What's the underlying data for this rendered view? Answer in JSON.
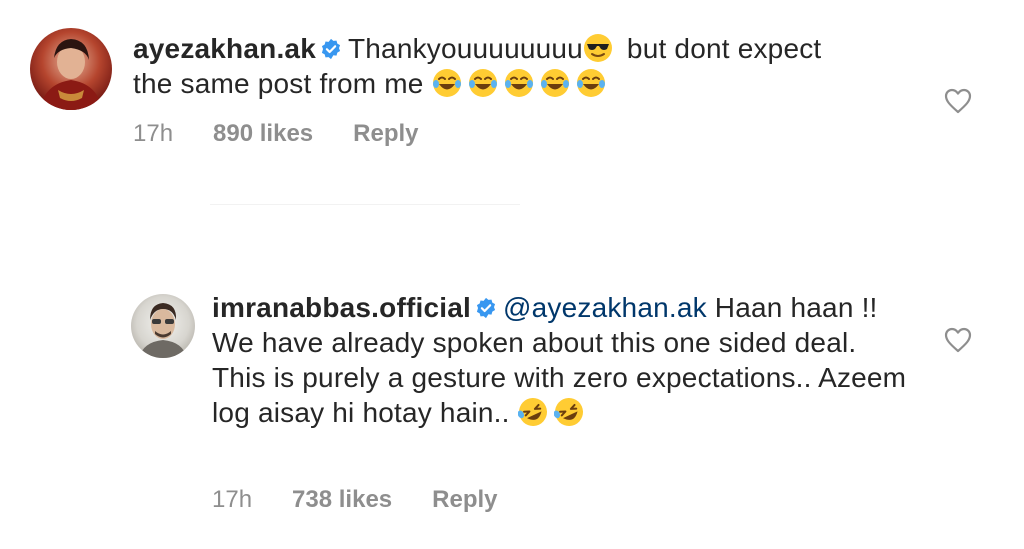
{
  "comments": [
    {
      "username": "ayezakhan.ak",
      "text_part1": "Thankyouuuuuuuu",
      "text_part2": " but dont expect the same post from me ",
      "time": "17h",
      "likes": "890 likes",
      "reply": "Reply"
    },
    {
      "username": "imranabbas.official",
      "mention": "@ayezakhan.ak",
      "text": " Haan haan !! We have already spoken about this one sided deal. This is purely a gesture with zero expectations.. Azeem log aisay hi hotay hain.. ",
      "time": "17h",
      "likes": "738 likes",
      "reply": "Reply"
    }
  ],
  "colors": {
    "verified": "#3897f0",
    "mention": "#00376b",
    "meta": "#8e8e8e",
    "text": "#262626"
  },
  "icons": {
    "verified": "verified-badge-icon",
    "heart": "heart-outline-icon",
    "sunglasses": "sunglasses-emoji",
    "laughing": "tears-of-joy-emoji",
    "rofl": "rolling-laughing-emoji"
  }
}
